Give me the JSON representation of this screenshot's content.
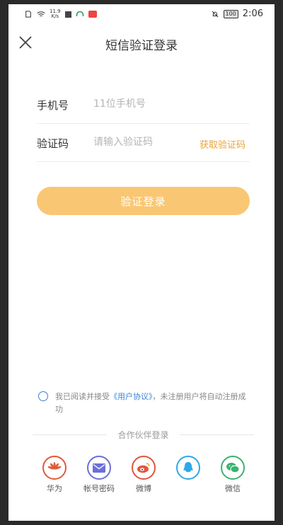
{
  "status_bar": {
    "net_speed": "11.9",
    "net_unit": "K/s",
    "battery": "100",
    "time": "2:06"
  },
  "header": {
    "title": "短信验证登录"
  },
  "form": {
    "phone_label": "手机号",
    "phone_placeholder": "11位手机号",
    "code_label": "验证码",
    "code_placeholder": "请输入验证码",
    "get_code": "获取验证码"
  },
  "login_button": "验证登录",
  "agreement": {
    "prefix": "我已阅读并接受",
    "link": "《用户协议》",
    "suffix": "，未注册用户将自动注册成功"
  },
  "partners": {
    "title": "合作伙伴登录",
    "items": [
      {
        "label": "华为",
        "icon": "huawei-icon",
        "color": "#e05a3a"
      },
      {
        "label": "帐号密码",
        "icon": "mail-icon",
        "color": "#6c6fd8"
      },
      {
        "label": "微博",
        "icon": "weibo-icon",
        "color": "#e0553c"
      },
      {
        "label": "",
        "icon": "qq-icon",
        "color": "#2fa8e6"
      },
      {
        "label": "微信",
        "icon": "wechat-icon",
        "color": "#3cb371"
      }
    ]
  },
  "colors": {
    "accent": "#e8a43c",
    "button": "#f9c774",
    "link": "#3a84d6"
  }
}
